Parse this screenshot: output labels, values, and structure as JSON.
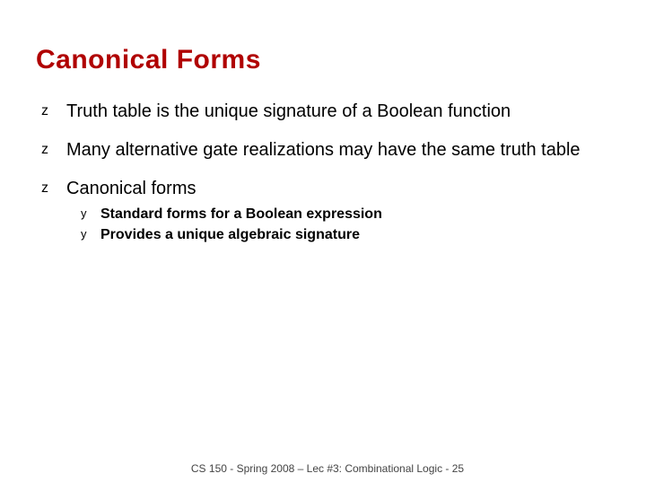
{
  "title": "Canonical Forms",
  "bullets": [
    {
      "text": "Truth table is the unique signature of a Boolean function"
    },
    {
      "text": "Many alternative gate realizations may have the same truth table"
    },
    {
      "text": "Canonical forms",
      "sub": [
        "Standard forms for a Boolean expression",
        "Provides a unique algebraic signature"
      ]
    }
  ],
  "footer": "CS 150 - Spring  2008 – Lec  #3: Combinational  Logic  - 25"
}
